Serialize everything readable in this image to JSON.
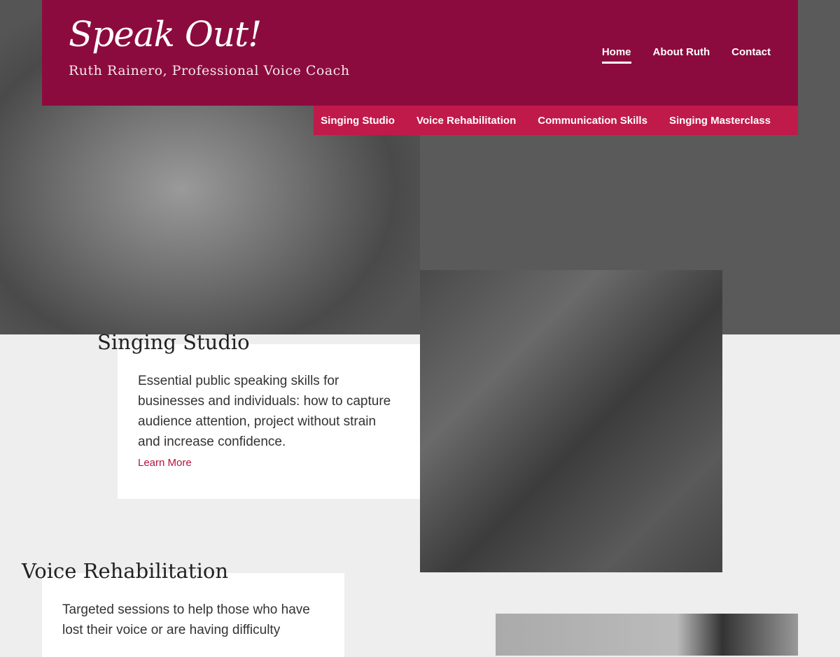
{
  "site": {
    "logo": "Speak Out!",
    "tagline": "Ruth Rainero, Professional Voice Coach"
  },
  "top_nav": [
    {
      "label": "Home",
      "active": true
    },
    {
      "label": "About Ruth"
    },
    {
      "label": "Contact"
    }
  ],
  "sub_nav": [
    {
      "label": "Singing Studio"
    },
    {
      "label": "Voice Rehabilitation"
    },
    {
      "label": "Communication Skills"
    },
    {
      "label": "Singing Masterclass"
    }
  ],
  "sections": [
    {
      "title": "Singing Studio",
      "text": "Essential public speaking skills for businesses and individuals: how to capture audience attention, project without strain and increase confidence.",
      "link": "Learn More"
    },
    {
      "title": "Voice Rehabilitation",
      "text": "Targeted sessions to help those who have lost their voice or are having difficulty"
    }
  ],
  "colors": {
    "header": "#8c0b3e",
    "subnav": "#c01a4a",
    "link": "#b5133f"
  }
}
